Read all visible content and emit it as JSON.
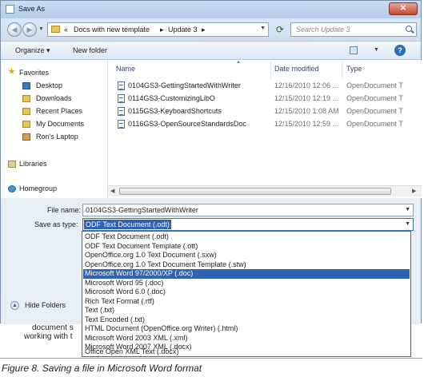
{
  "window": {
    "title": "Save As",
    "close_glyph": "✕"
  },
  "nav": {
    "back_glyph": "◀",
    "forward_glyph": "▶",
    "breadcrumb_prefix": "«",
    "breadcrumb": [
      "Docs with new template",
      "Update 3"
    ],
    "search_placeholder": "Search Update 3"
  },
  "toolbar": {
    "organize": "Organize ▾",
    "new_folder": "New folder",
    "help": "?"
  },
  "sidebar": {
    "favorites": "Favorites",
    "items": [
      "Desktop",
      "Downloads",
      "Recent Places",
      "My Documents",
      "Ron's Laptop"
    ],
    "libraries": "Libraries",
    "homegroup": "Homegroup"
  },
  "columns": {
    "name": "Name",
    "date": "Date modified",
    "type": "Type"
  },
  "files": [
    {
      "name": "0104GS3-GettingStartedWithWriter",
      "date": "12/16/2010 12:06 ...",
      "type": "OpenDocument T"
    },
    {
      "name": "0114GS3-CustomizingLibO",
      "date": "12/15/2010 12:19 ...",
      "type": "OpenDocument T"
    },
    {
      "name": "0115GS3-KeyboardShortcuts",
      "date": "12/15/2010 1:08 AM",
      "type": "OpenDocument T"
    },
    {
      "name": "0116GS3-OpenSourceStandardsDoc",
      "date": "12/15/2010 12:59 ...",
      "type": "OpenDocument T"
    }
  ],
  "form": {
    "file_name_label": "File name:",
    "file_name_value": "0104GS3-GettingStartedWithWriter",
    "save_type_label": "Save as type:",
    "save_type_value": "ODF Text Document (.odt)",
    "hide_folders": "Hide Folders"
  },
  "dropdown": {
    "options": [
      "ODF Text Document (.odt)",
      "ODF Text Document Template (.ott)",
      "OpenOffice.org 1.0 Text Document (.sxw)",
      "OpenOffice.org 1.0 Text Document Template (.stw)",
      "Microsoft Word 97/2000/XP (.doc)",
      "Microsoft Word 95 (.doc)",
      "Microsoft Word 6.0 (.doc)",
      "Rich Text Format (.rtf)",
      "Text (.txt)",
      "Text Encoded (.txt)",
      "HTML Document (OpenOffice.org Writer) (.html)",
      "Microsoft Word 2003 XML (.xml)",
      "Microsoft Word 2007 XML (.docx)",
      "Office Open XML Text (.docx)"
    ],
    "selected_index": 4
  },
  "background": {
    "line1": "document s",
    "line2": "working with t"
  },
  "caption": "Figure 8. Saving a file in Microsoft Word format",
  "colors": {
    "accent": "#3163b2",
    "dialog_bg": "#e8eef6"
  }
}
